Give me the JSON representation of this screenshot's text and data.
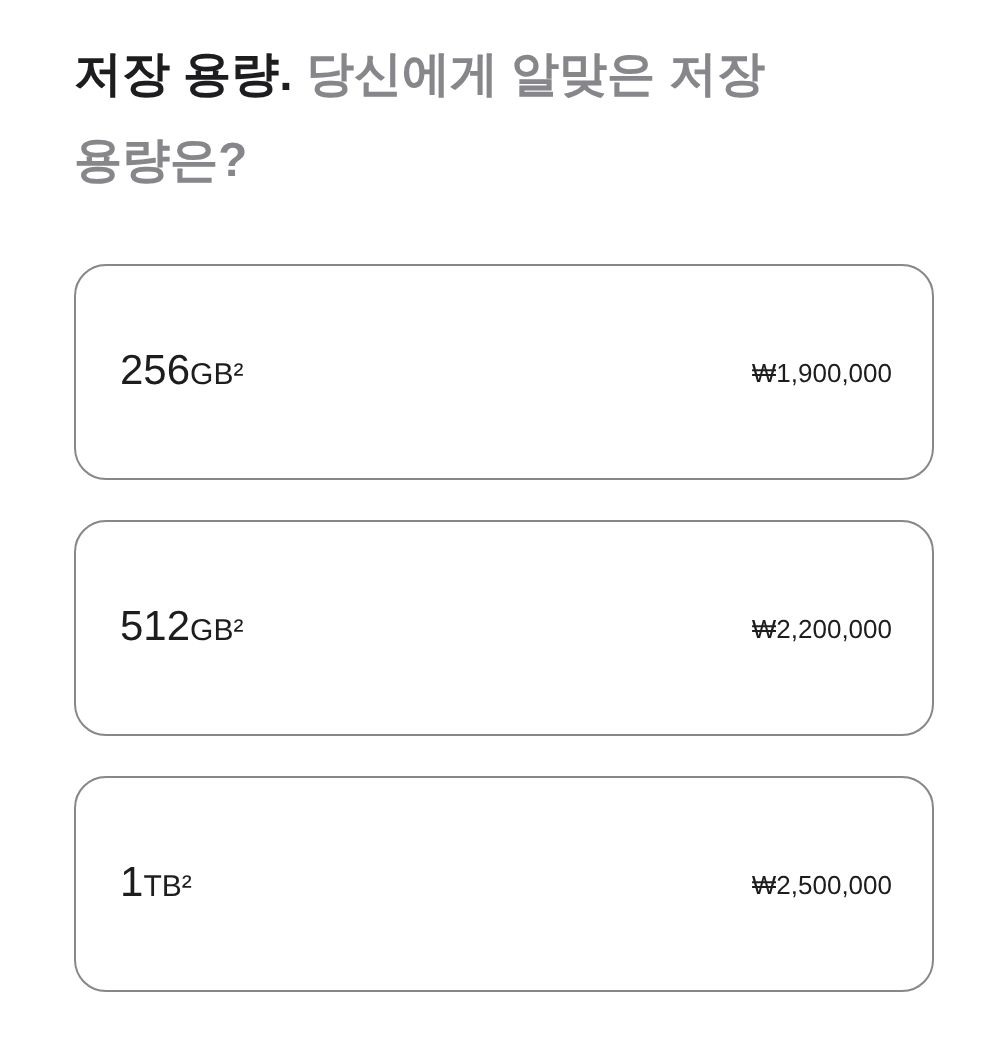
{
  "heading": {
    "title": "저장 용량.",
    "subtitle": "당신에게 알맞은 저장 용량은?"
  },
  "options": [
    {
      "amount": "256",
      "unit": "GB²",
      "price": "₩1,900,000",
      "selected": false
    },
    {
      "amount": "512",
      "unit": "GB²",
      "price": "₩2,200,000",
      "selected": false
    },
    {
      "amount": "1",
      "unit": "TB²",
      "price": "₩2,500,000",
      "selected": false
    }
  ]
}
